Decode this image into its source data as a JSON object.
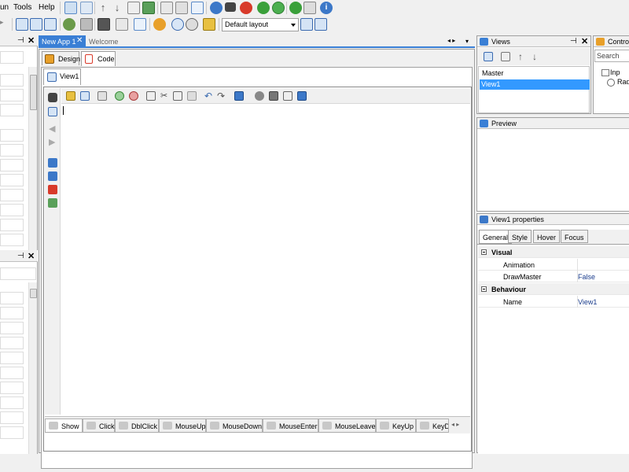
{
  "menu": [
    "un",
    "Tools",
    "Help"
  ],
  "layout_select": "Default layout",
  "document_tabs": [
    {
      "label": "New App 1",
      "active": true
    },
    {
      "label": "Welcome",
      "active": false
    }
  ],
  "editor_tabs": [
    {
      "label": "Design",
      "active": false
    },
    {
      "label": "Code",
      "active": true
    }
  ],
  "view_tab": "View1",
  "event_tabs": [
    "Show",
    "Click",
    "DblClick",
    "MouseUp",
    "MouseDown",
    "MouseEnter",
    "MouseLeave",
    "KeyUp",
    "KeyDo"
  ],
  "views_panel": {
    "title": "Views",
    "items": [
      "Master",
      "View1"
    ],
    "selected": "View1"
  },
  "controls_panel": {
    "title": "Control",
    "search_placeholder": "Search",
    "items": [
      "Inp",
      "Rad"
    ]
  },
  "preview_panel": {
    "title": "Preview"
  },
  "properties_panel": {
    "title": "View1 properties",
    "tabs": [
      "General",
      "Style",
      "Hover",
      "Focus"
    ],
    "active_tab": "General",
    "sections": [
      {
        "name": "Visual",
        "rows": [
          {
            "name": "Animation",
            "value": ""
          },
          {
            "name": "DrawMaster",
            "value": "False"
          }
        ]
      },
      {
        "name": "Behaviour",
        "rows": [
          {
            "name": "Name",
            "value": "View1"
          }
        ]
      }
    ]
  },
  "colors": {
    "accent": "#3a7fd5",
    "selection": "#3399ff",
    "value_text": "#1a3c8c"
  }
}
